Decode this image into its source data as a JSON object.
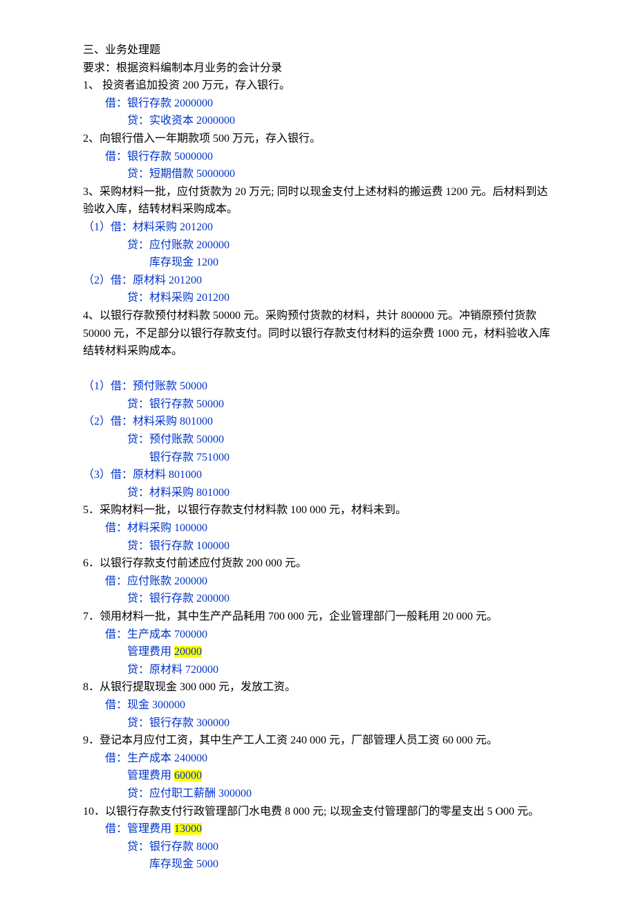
{
  "title": "三、业务处理题",
  "req": "要求：根据资料编制本月业务的会计分录",
  "q1": {
    "text": "1、 投资者追加投资 200 万元，存入银行。",
    "dr": "借：银行存款 2000000",
    "cr": "贷：实收资本   2000000"
  },
  "q2": {
    "text": "2、向银行借入一年期款项 500 万元，存入银行。",
    "dr": "借：银行存款 5000000",
    "cr": "贷：短期借款 5000000"
  },
  "q3": {
    "text": "3、采购材料一批，应付货款为 20 万元; 同时以现金支付上述材料的搬运费 1200 元。后材料到达验收入库，结转材料采购成本。",
    "e1dr": "（1）借：材料采购 201200",
    "e1cr1": "贷：应付账款 200000",
    "e1cr2": "库存现金    1200",
    "e2dr": "（2）借：原材料 201200",
    "e2cr": "贷：材料采购 201200"
  },
  "q4": {
    "text": "4、以银行存款预付材料款 50000 元。采购预付货款的材料，共计 800000 元。冲销原预付货款50000 元，不足部分以银行存款支付。同时以银行存款支付材料的运杂费 1000 元，材料验收入库结转材料采购成本。",
    "e1dr": "（1）借：预付账款 50000",
    "e1cr": "贷：银行存款 50000",
    "e2dr": "（2）借：材料采购 801000",
    "e2cr1": "贷：预付账款 50000",
    "e2cr2": "银行存款 751000",
    "e3dr": "（3）借：原材料 801000",
    "e3cr": "贷：材料采购 801000"
  },
  "q5": {
    "text": "5．采购材料一批，以银行存款支付材料款 100 000 元，材料未到。",
    "dr": "借：材料采购 100000",
    "cr": "贷：银行存款 100000"
  },
  "q6": {
    "text": "6．以银行存款支付前述应付货款 200 000 元。",
    "dr": "借：应付账款 200000",
    "cr": "贷：银行存款 200000"
  },
  "q7": {
    "text": "7．领用材料一批，其中生产产品耗用 700 000 元，企业管理部门一般耗用 20 000 元。",
    "dr1": "借：生产成本 700000",
    "dr2a": "管理费用  ",
    "dr2b": "20000",
    "cr": "贷：原材料 720000"
  },
  "q8": {
    "text": "8．从银行提取现金 300 000 元，发放工资。",
    "dr": "借：现金 300000",
    "cr": "贷：银行存款 300000"
  },
  "q9": {
    "text": "9．登记本月应付工资，其中生产工人工资 240 000 元，厂部管理人员工资 60 000 元。",
    "dr1": "借：生产成本 240000",
    "dr2a": "管理费用  ",
    "dr2b": "60000",
    "cr": "贷：应付职工薪酬 300000"
  },
  "q10": {
    "text": "10．以银行存款支付行政管理部门水电费 8 000 元; 以现金支付管理部门的零星支出 5 O00 元。",
    "dr1a": "借：管理费用 ",
    "dr1b": "13000",
    "cr1": "贷：银行存款 8000",
    "cr2": "库存现金 5000"
  }
}
